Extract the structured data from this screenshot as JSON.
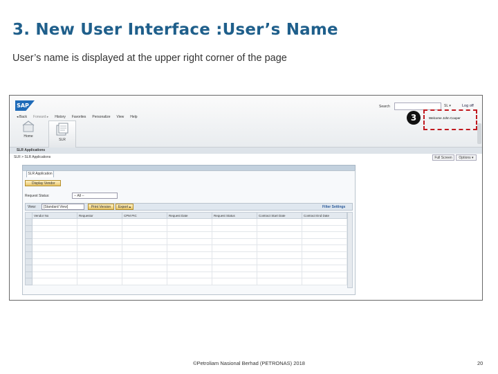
{
  "slide": {
    "title": "3. New User Interface :User’s Name",
    "subtitle": "User’s name is displayed at the upper right corner of the page",
    "footer": "©Petroliam Nasional Berhad (PETRONAS) 2018",
    "page_number": "20"
  },
  "screenshot": {
    "logo": "SAP",
    "search_label": "Search",
    "search_option": "SL ▾",
    "logoff": "Log off",
    "menu": [
      "◂ Back",
      "Forward ▸",
      "History",
      "Favorites",
      "Personalize",
      "View",
      "Help"
    ],
    "tiles": [
      "Home",
      "SLR"
    ],
    "welcome": "Welcome John Cooper",
    "callout_number": "3",
    "subnav": "SLR Applications",
    "breadcrumb": "SLR > SLR Applications",
    "full_screen_btn": "Full Screen",
    "options_btn": "Options ▾",
    "tab_label": "SLR Application",
    "display_btn": "Display Vendor",
    "request_status_label": "Request Status:",
    "request_status_value": "-- All --",
    "view_label": "View:",
    "view_value": "[Standard View]",
    "print_btn": "Print Version",
    "export_btn": "Export ▴",
    "filter_link": "Filter Settings",
    "columns": [
      "Vendor No",
      "Requestor",
      "CPM PIC",
      "Request Date",
      "Request Status",
      "Contract Start Date",
      "Contract End Date"
    ]
  },
  "colors": {
    "title": "#1f5f8b",
    "highlight": "#c0181e",
    "sap_blue": "#1f6bb8"
  }
}
